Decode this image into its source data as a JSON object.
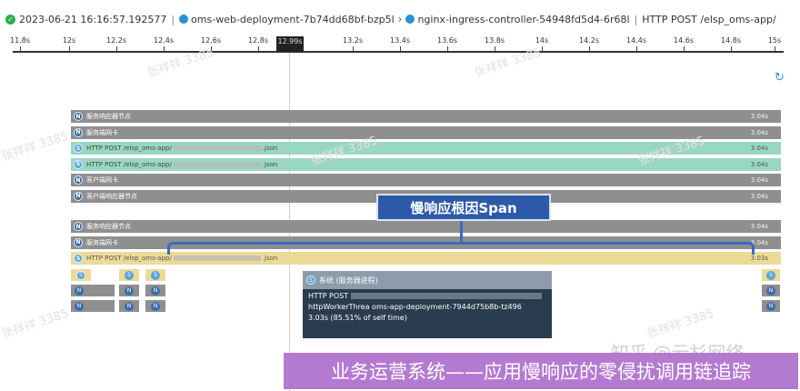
{
  "header": {
    "timestamp": "2023-06-21 16:16:57.192577",
    "service": "oms-web-deployment-7b74dd68bf-bzp5l",
    "controller": "nginx-ingress-controller-54948fd5d4-6r68l",
    "request": "HTTP POST /elsp_oms-app/"
  },
  "ruler": {
    "ticks": [
      "11.8s",
      "12s",
      "12.2s",
      "12.4s",
      "12.6s",
      "12.8s",
      "13.2s",
      "13.4s",
      "13.6s",
      "13.8s",
      "14s",
      "14.2s",
      "14.4s",
      "14.6s",
      "14.8s",
      "15s"
    ],
    "cursor_label": "12.99s"
  },
  "icons": {
    "refresh": "refresh-icon"
  },
  "spans_group1": [
    {
      "kind": "N",
      "label": "服务响应器节点",
      "duration": "3.04s",
      "color": "gray"
    },
    {
      "kind": "N",
      "label": "服务端网卡",
      "duration": "3.04s",
      "color": "gray"
    },
    {
      "kind": "S",
      "label": "HTTP POST /elsp_oms-app/",
      "suffix": ".json",
      "duration": "3.04s",
      "color": "green"
    },
    {
      "kind": "S",
      "label": "HTTP POST /elsp_oms-app/",
      "suffix": ".json",
      "duration": "3.04s",
      "color": "green"
    },
    {
      "kind": "N",
      "label": "客户端网卡",
      "duration": "3.04s",
      "color": "gray"
    },
    {
      "kind": "N",
      "label": "客户端响应器节点",
      "duration": "3.04s",
      "color": "gray"
    }
  ],
  "spans_group2": [
    {
      "kind": "N",
      "label": "服务响应器节点",
      "duration": "3.04s",
      "color": "gray"
    },
    {
      "kind": "N",
      "label": "服务端网卡",
      "duration": "3.04s",
      "color": "gray"
    },
    {
      "kind": "S",
      "label": "HTTP POST /elsp_oms-app/",
      "suffix": ".json",
      "duration": "3.03s",
      "color": "yellow"
    }
  ],
  "callout": "慢响应根因Span",
  "tooltip": {
    "title": "系统 (服务器进程)",
    "line1": "HTTP POST",
    "line2": "httpWorkerThrea oms-app-deployment-7944d75b8b-tz496",
    "line3": "3.03s (85.51% of self time)"
  },
  "banner": "业务运营系统——应用慢响应的零侵扰调用链追踪",
  "watermark_brand": "知乎 @云杉网络",
  "watermark_user": "张祥祥 3385"
}
